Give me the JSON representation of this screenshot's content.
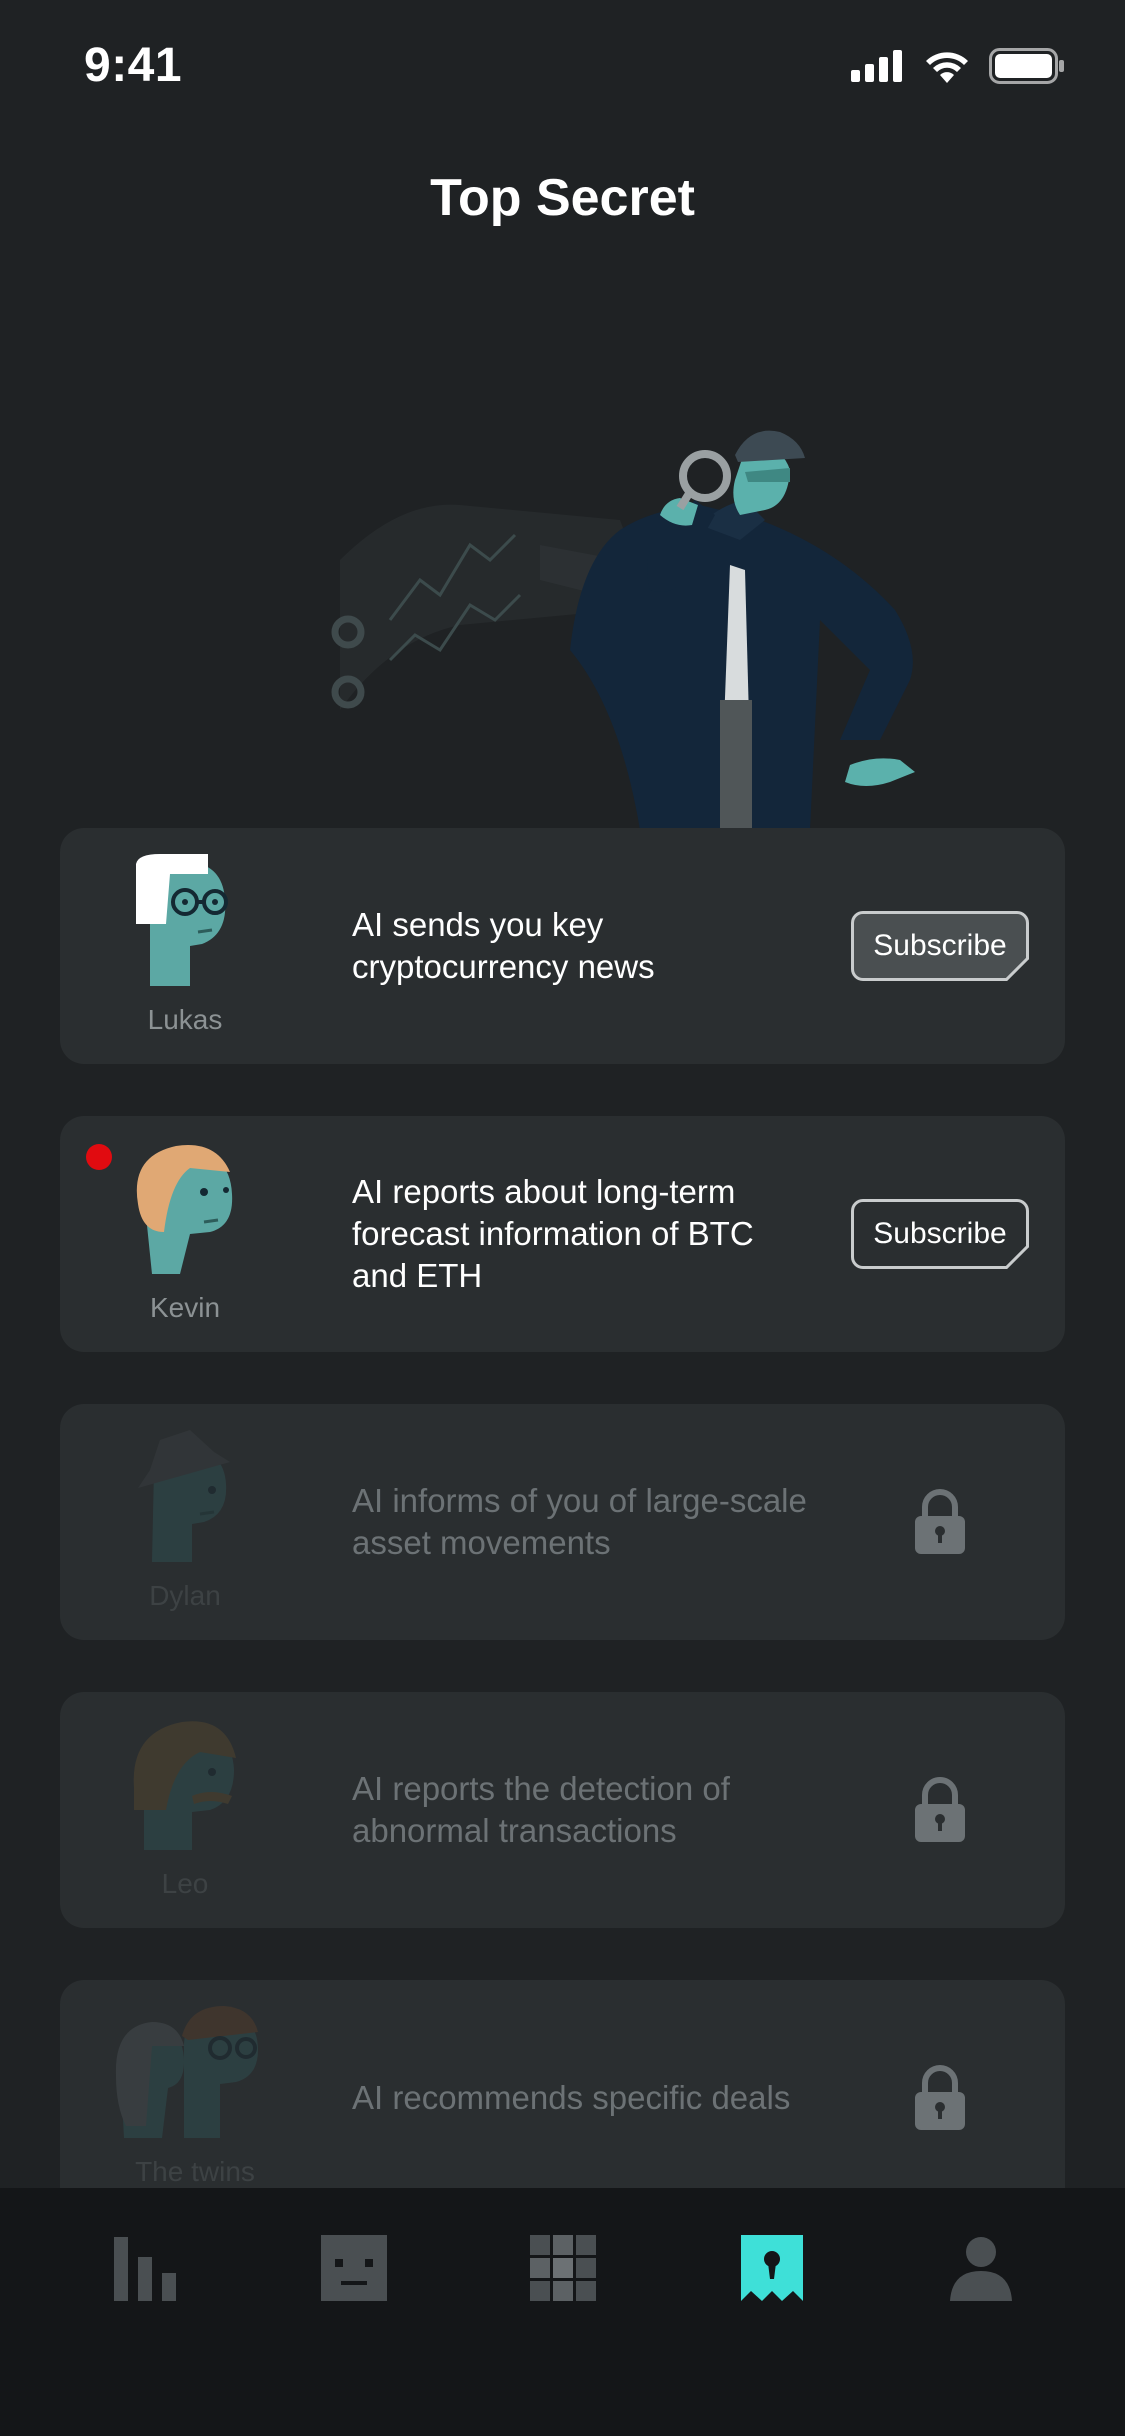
{
  "status_bar": {
    "time": "9:41"
  },
  "page_title": "Top Secret",
  "cards": [
    {
      "name": "Lukas",
      "description": "AI sends you key cryptocurrency news",
      "action": "Subscribe"
    },
    {
      "name": "Kevin",
      "description": "AI reports about long-term forecast information of BTC and ETH",
      "action": "Subscribe"
    },
    {
      "name": "Dylan",
      "description": "AI informs of you of large-scale asset movements",
      "action": "locked"
    },
    {
      "name": "Leo",
      "description": "AI reports the detection of abnormal transactions",
      "action": "locked"
    },
    {
      "name": "The twins",
      "description": "AI recommends specific deals",
      "action": "locked"
    }
  ],
  "tab_bar": {
    "tabs": [
      {
        "icon": "chart-bars-icon",
        "active": false
      },
      {
        "icon": "robot-face-icon",
        "active": false
      },
      {
        "icon": "grid-icon",
        "active": false
      },
      {
        "icon": "keyhole-bookmark-icon",
        "active": true
      },
      {
        "icon": "profile-icon",
        "active": false
      }
    ]
  },
  "colors": {
    "background": "#1f2224",
    "card": "#2a2e30",
    "accent": "#3ee0d8",
    "notification_dot": "#e10b10",
    "tab_bar": "#141618"
  }
}
